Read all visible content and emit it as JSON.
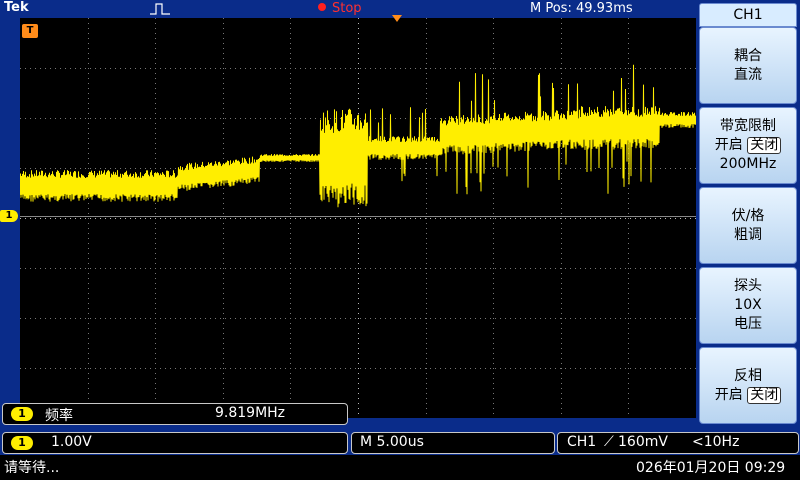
{
  "header": {
    "brand": "Tek",
    "run_state": "Stop",
    "m_pos_label": "M Pos:",
    "m_pos_value": "49.93ms"
  },
  "markers": {
    "channel": "1",
    "trigger": "T"
  },
  "side_menu": {
    "title": "CH1",
    "buttons": [
      {
        "line1": "耦合",
        "line2": "直流"
      },
      {
        "line1": "带宽限制",
        "line2_prefix": "开启",
        "line2_box": "关闭",
        "line3": "200MHz"
      },
      {
        "line1": "伏/格",
        "line2": "粗调"
      },
      {
        "line1": "探头",
        "line2": "10X",
        "line3": "电压"
      },
      {
        "line1": "反相",
        "line2_prefix": "开启",
        "line2_box": "关闭"
      }
    ]
  },
  "measurement": {
    "channel": "1",
    "label": "频率",
    "value": "9.819MHz"
  },
  "bottom": {
    "channel": "1",
    "volts_div": "1.00V",
    "timebase": "M 5.00us",
    "trigger_source": "CH1",
    "trigger_slope": "⟋",
    "trigger_level": "160mV",
    "trigger_freq": "<10Hz"
  },
  "statusline": {
    "message": "请等待...",
    "datetime": "026年01月20日  09:29"
  },
  "colors": {
    "trace": "#ffee00",
    "background": "#0a2c8a",
    "screen": "#000000",
    "trigger_marker": "#ff8c1a",
    "stop": "#ff3030"
  }
}
